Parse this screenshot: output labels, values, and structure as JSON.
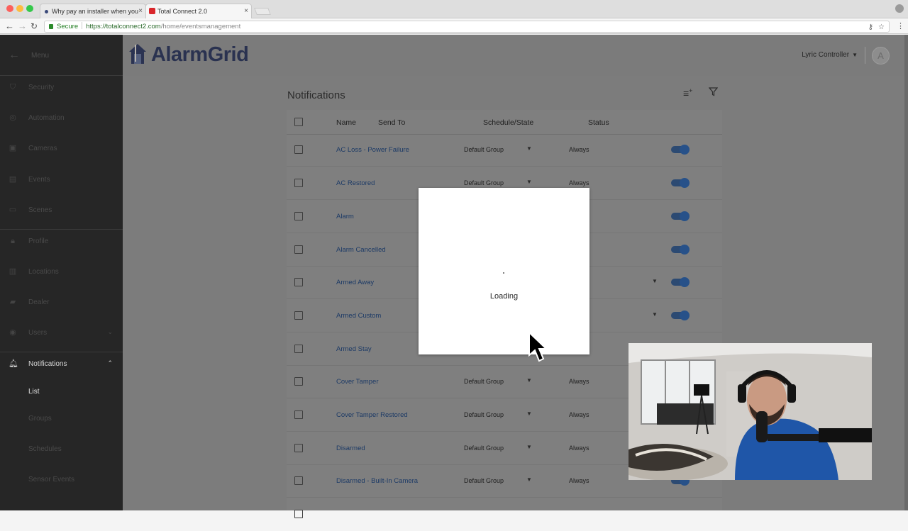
{
  "browser": {
    "tabs": [
      {
        "title": "Why pay an installer when you",
        "active": false
      },
      {
        "title": "Total Connect 2.0",
        "active": true
      }
    ],
    "close_glyph": "×",
    "security_label": "Secure",
    "url_host": "https://totalconnect2.com",
    "url_path": "/home/eventsmanagement"
  },
  "sidebar": {
    "menu_label": "Menu",
    "items": [
      {
        "label": "Security",
        "icon": "shield-icon"
      },
      {
        "label": "Automation",
        "icon": "automation-icon"
      },
      {
        "label": "Cameras",
        "icon": "camera-icon"
      },
      {
        "label": "Events",
        "icon": "events-icon"
      },
      {
        "label": "Scenes",
        "icon": "scenes-icon"
      },
      {
        "label": "Profile",
        "icon": "lock-icon"
      },
      {
        "label": "Locations",
        "icon": "building-icon"
      },
      {
        "label": "Dealer",
        "icon": "truck-icon"
      },
      {
        "label": "Users",
        "icon": "users-icon"
      },
      {
        "label": "Notifications",
        "icon": "bell-icon"
      }
    ],
    "sub_items": [
      "List",
      "Groups",
      "Schedules",
      "Sensor Events"
    ],
    "current_sub": "List"
  },
  "header": {
    "logo_text": "AlarmGrid",
    "controller": "Lyric Controller",
    "avatar_initial": "A"
  },
  "page": {
    "title": "Notifications",
    "columns": {
      "name": "Name",
      "send_to": "Send To",
      "schedule": "Schedule/State",
      "status": "Status"
    },
    "rows": [
      {
        "name": "AC Loss - Power Failure",
        "group": "Default Group",
        "state": "Always",
        "enabled": true
      },
      {
        "name": "AC Restored",
        "group": "Default Group",
        "state": "Always",
        "enabled": true
      },
      {
        "name": "Alarm",
        "group": "",
        "state": "",
        "enabled": true
      },
      {
        "name": "Alarm Cancelled",
        "group": "",
        "state": "",
        "enabled": true
      },
      {
        "name": "Armed Away",
        "group": "",
        "state": "",
        "enabled": true
      },
      {
        "name": "Armed Custom",
        "group": "",
        "state": "",
        "enabled": true
      },
      {
        "name": "Armed Stay",
        "group": "",
        "state": "",
        "enabled": true
      },
      {
        "name": "Cover Tamper",
        "group": "Default Group",
        "state": "Always",
        "enabled": true
      },
      {
        "name": "Cover Tamper Restored",
        "group": "Default Group",
        "state": "Always",
        "enabled": true
      },
      {
        "name": "Disarmed",
        "group": "Default Group",
        "state": "Always",
        "enabled": true
      },
      {
        "name": "Disarmed - Built-In Camera",
        "group": "Default Group",
        "state": "Always",
        "enabled": true
      }
    ]
  },
  "modal": {
    "text": "Loading"
  },
  "colors": {
    "sidebar_bg": "#262626",
    "overlay_bg": "#7c7c7c",
    "link": "#1c3a66",
    "toggle": "#275189"
  }
}
